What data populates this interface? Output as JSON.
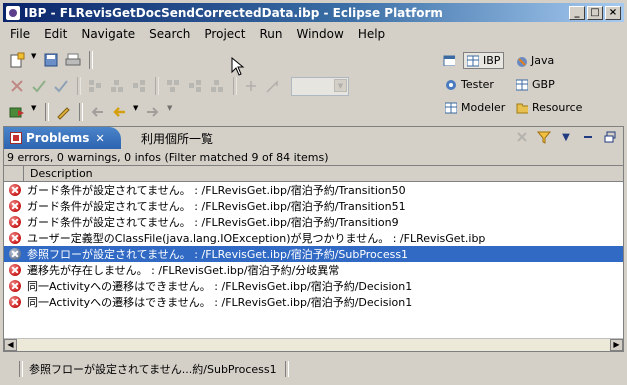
{
  "window": {
    "title": "IBP - FLRevisGetDocSendCorrectedData.ibp - Eclipse Platform",
    "controls": {
      "minimize": "_",
      "maximize": "□",
      "close": "×"
    }
  },
  "menubar": {
    "items": [
      "File",
      "Edit",
      "Navigate",
      "Search",
      "Project",
      "Run",
      "Window",
      "Help"
    ]
  },
  "perspectives": {
    "items": [
      {
        "label": "IBP",
        "icon": "ibp-perspective-icon",
        "active": true
      },
      {
        "label": "Java",
        "icon": "java-perspective-icon"
      },
      {
        "label": "Tester",
        "icon": "tester-perspective-icon"
      },
      {
        "label": "GBP",
        "icon": "gbp-perspective-icon"
      },
      {
        "label": "Modeler",
        "icon": "modeler-perspective-icon"
      },
      {
        "label": "Resource",
        "icon": "resource-perspective-icon"
      }
    ]
  },
  "problems_view": {
    "tabs": [
      {
        "label": "Problems",
        "active": true,
        "close": "✕"
      },
      {
        "label": "利用個所一覧"
      }
    ],
    "filter_summary": "9 errors, 0 warnings, 0 infos (Filter matched 9 of 84 items)",
    "column_header": "Description",
    "rows": [
      {
        "text": "ガード条件が設定されてません。 : /FLRevisGet.ibp/宿泊予約/Transition50",
        "selected": false
      },
      {
        "text": "ガード条件が設定されてません。 : /FLRevisGet.ibp/宿泊予約/Transition51",
        "selected": false
      },
      {
        "text": "ガード条件が設定されてません。 : /FLRevisGet.ibp/宿泊予約/Transition9",
        "selected": false
      },
      {
        "text": "ユーザー定義型のClassFile(java.lang.IOException)が見つかりません。 : /FLRevisGet.ibp",
        "selected": false
      },
      {
        "text": "参照フローが設定されてません。 : /FLRevisGet.ibp/宿泊予約/SubProcess1",
        "selected": true
      },
      {
        "text": "遷移先が存在しません。 : /FLRevisGet.ibp/宿泊予約/分岐異常",
        "selected": false
      },
      {
        "text": "同一Activityへの遷移はできません。 : /FLRevisGet.ibp/宿泊予約/Decision1",
        "selected": false
      },
      {
        "text": "同一Activityへの遷移はできません。 : /FLRevisGet.ibp/宿泊予約/Decision1",
        "selected": false
      }
    ]
  },
  "statusbar": {
    "message": "参照フローが設定されてません...約/SubProcess1"
  },
  "colors": {
    "selection": "#316ac5",
    "titlebar_start": "#0a246a",
    "titlebar_end": "#a6caf0",
    "error": "#c81818"
  }
}
